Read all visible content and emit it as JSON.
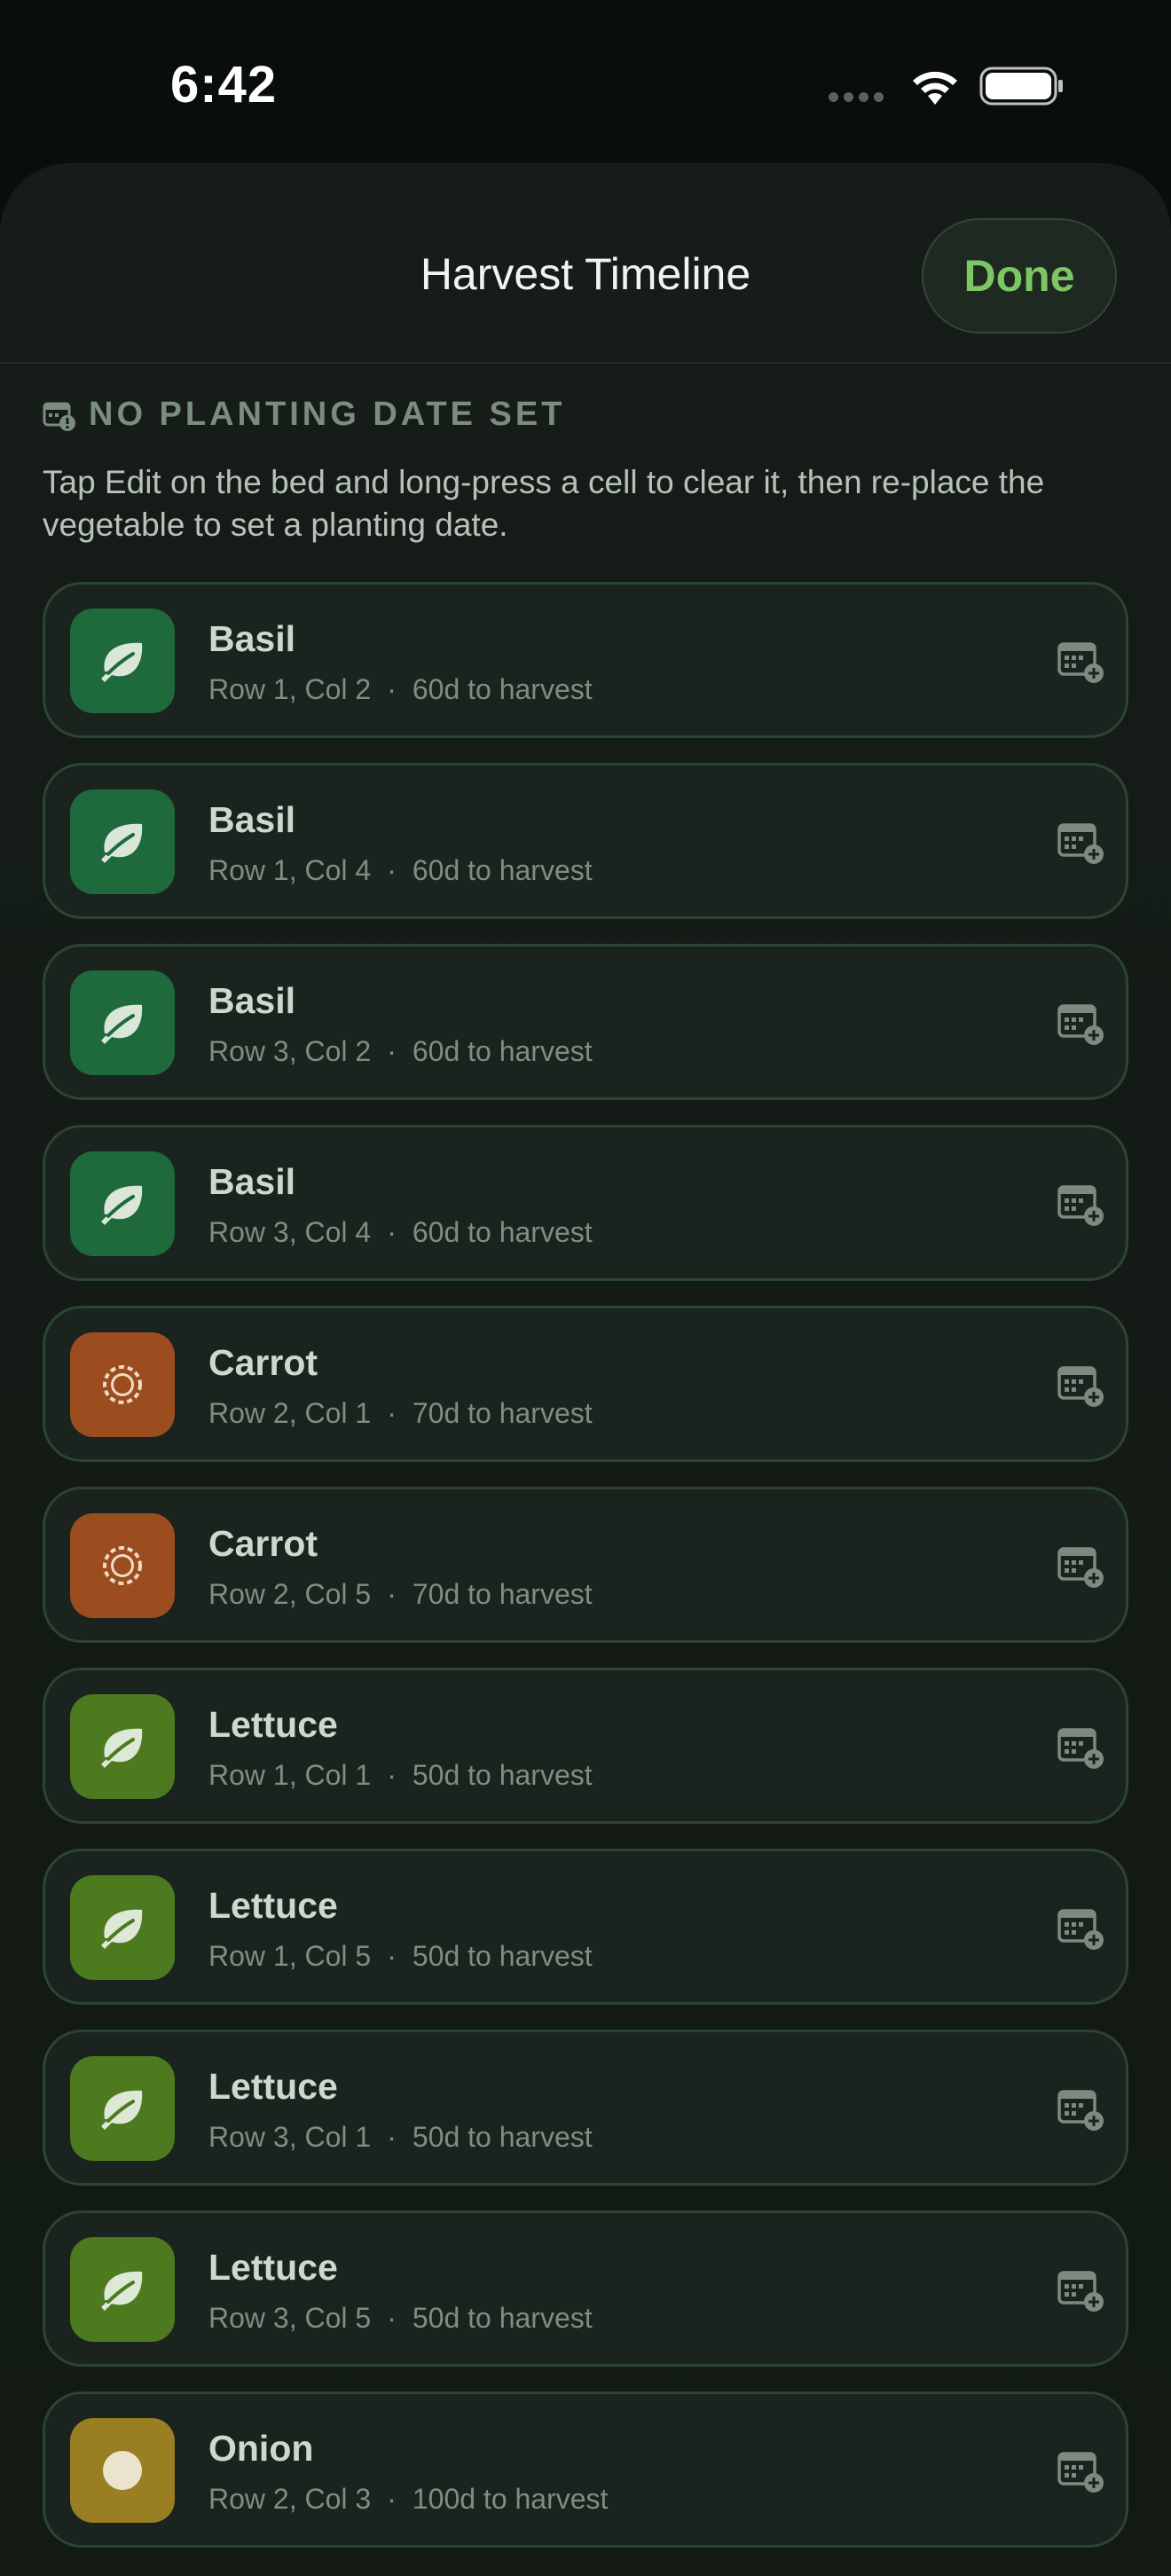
{
  "status_bar": {
    "time": "6:42"
  },
  "header": {
    "title": "Harvest Timeline",
    "done_label": "Done"
  },
  "section": {
    "title": "NO PLANTING DATE SET",
    "description": "Tap Edit on the bed and long-press a cell to clear it, then re-place the vegetable to set a planting date."
  },
  "plants": [
    {
      "name": "Basil",
      "location": "Row 1, Col 2",
      "days": "60d to harvest",
      "icon": "leaf-icon",
      "color": "#1e6a3c"
    },
    {
      "name": "Basil",
      "location": "Row 1, Col 4",
      "days": "60d to harvest",
      "icon": "leaf-icon",
      "color": "#1e6a3c"
    },
    {
      "name": "Basil",
      "location": "Row 3, Col 2",
      "days": "60d to harvest",
      "icon": "leaf-icon",
      "color": "#1e6a3c"
    },
    {
      "name": "Basil",
      "location": "Row 3, Col 4",
      "days": "60d to harvest",
      "icon": "leaf-icon",
      "color": "#1e6a3c"
    },
    {
      "name": "Carrot",
      "location": "Row 2, Col 1",
      "days": "70d to harvest",
      "icon": "carrot-ring-icon",
      "color": "#9c4d1f"
    },
    {
      "name": "Carrot",
      "location": "Row 2, Col 5",
      "days": "70d to harvest",
      "icon": "carrot-ring-icon",
      "color": "#9c4d1f"
    },
    {
      "name": "Lettuce",
      "location": "Row 1, Col 1",
      "days": "50d to harvest",
      "icon": "leaf-icon",
      "color": "#4d7a1e"
    },
    {
      "name": "Lettuce",
      "location": "Row 1, Col 5",
      "days": "50d to harvest",
      "icon": "leaf-icon",
      "color": "#4d7a1e"
    },
    {
      "name": "Lettuce",
      "location": "Row 3, Col 1",
      "days": "50d to harvest",
      "icon": "leaf-icon",
      "color": "#4d7a1e"
    },
    {
      "name": "Lettuce",
      "location": "Row 3, Col 5",
      "days": "50d to harvest",
      "icon": "leaf-icon",
      "color": "#4d7a1e"
    },
    {
      "name": "Onion",
      "location": "Row 2, Col 3",
      "days": "100d to harvest",
      "icon": "onion-circle-icon",
      "color": "#9a7f22"
    }
  ],
  "separator": "·",
  "colors": {
    "accent": "#7ec563",
    "card_border": "#2c4533"
  }
}
